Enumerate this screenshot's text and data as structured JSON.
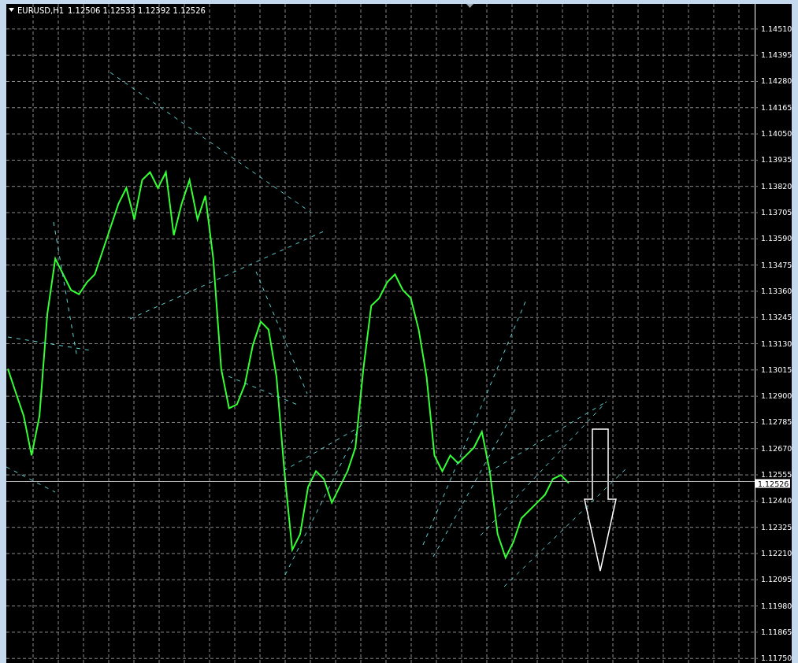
{
  "header": {
    "quotes": [
      "1.12506",
      "1.12533",
      "1.12392",
      "1.12526"
    ]
  },
  "chart": {
    "current_price": "1.12526",
    "chart_data": {
      "type": "line",
      "grid": true,
      "ylim": [
        1.1173,
        1.1462
      ],
      "yticks": [
        {
          "value": 1.1451,
          "label": "1.14510"
        },
        {
          "value": 1.14395,
          "label": "1.14395"
        },
        {
          "value": 1.1428,
          "label": "1.14280"
        },
        {
          "value": 1.14165,
          "label": "1.14165"
        },
        {
          "value": 1.1405,
          "label": "1.14050"
        },
        {
          "value": 1.13935,
          "label": "1.13935"
        },
        {
          "value": 1.1382,
          "label": "1.13820"
        },
        {
          "value": 1.13705,
          "label": "1.13705"
        },
        {
          "value": 1.1359,
          "label": "1.13590"
        },
        {
          "value": 1.13475,
          "label": "1.13475"
        },
        {
          "value": 1.1336,
          "label": "1.13360"
        },
        {
          "value": 1.13245,
          "label": "1.13245"
        },
        {
          "value": 1.1313,
          "label": "1.13130"
        },
        {
          "value": 1.13015,
          "label": "1.13015"
        },
        {
          "value": 1.129,
          "label": "1.12900"
        },
        {
          "value": 1.12785,
          "label": "1.12785"
        },
        {
          "value": 1.1267,
          "label": "1.12670"
        },
        {
          "value": 1.12555,
          "label": "1.12555"
        },
        {
          "value": 1.1244,
          "label": "1.12440"
        },
        {
          "value": 1.12325,
          "label": "1.12325"
        },
        {
          "value": 1.1221,
          "label": "1.12210"
        },
        {
          "value": 1.12095,
          "label": "1.12095"
        },
        {
          "value": 1.1198,
          "label": "1.11980"
        },
        {
          "value": 1.11865,
          "label": "1.11865"
        },
        {
          "value": 1.1175,
          "label": "1.11750"
        }
      ],
      "series": [
        {
          "name": "EURUSD,H1",
          "color": "#33ff33",
          "values": [
            1.1302,
            1.12916,
            1.12813,
            1.1264,
            1.12813,
            1.13261,
            1.13503,
            1.13434,
            1.13365,
            1.13347,
            1.13399,
            1.13434,
            1.13537,
            1.13641,
            1.13744,
            1.13813,
            1.13675,
            1.13848,
            1.13882,
            1.13813,
            1.13882,
            1.13606,
            1.13744,
            1.13848,
            1.13675,
            1.13779,
            1.13503,
            1.1302,
            1.12847,
            1.12864,
            1.12951,
            1.13123,
            1.13227,
            1.13192,
            1.12985,
            1.12571,
            1.12226,
            1.12295,
            1.12502,
            1.12571,
            1.12537,
            1.12433,
            1.12502,
            1.12571,
            1.12675,
            1.1302,
            1.13297,
            1.1333,
            1.13399,
            1.13434,
            1.13365,
            1.1333,
            1.13192,
            1.12985,
            1.1264,
            1.12571,
            1.1264,
            1.12606,
            1.1264,
            1.12675,
            1.12744,
            1.12571,
            1.12295,
            1.12192,
            1.12261,
            1.12364,
            1.12399,
            1.12433,
            1.12468,
            1.12537,
            1.12554,
            1.12519
          ]
        }
      ]
    }
  }
}
